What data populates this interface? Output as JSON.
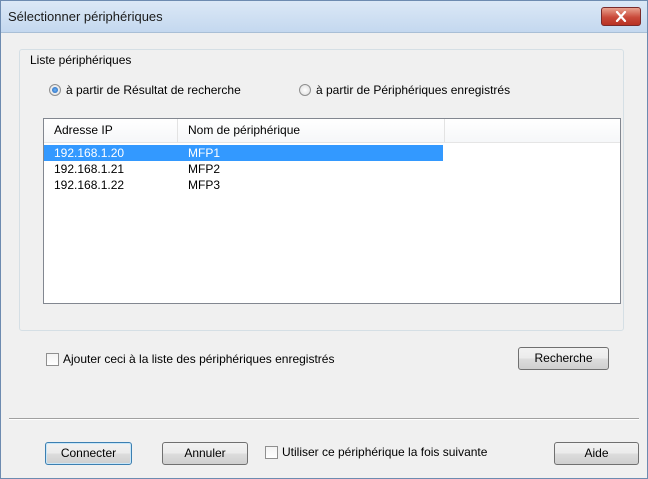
{
  "window": {
    "title": "Sélectionner périphériques"
  },
  "group": {
    "label": "Liste périphériques"
  },
  "radios": [
    {
      "label": "à partir de Résultat de recherche",
      "checked": true
    },
    {
      "label": "à partir de Périphériques enregistrés",
      "checked": false
    }
  ],
  "table": {
    "columns": [
      "Adresse IP",
      "Nom de périphérique"
    ],
    "rows": [
      {
        "ip": "192.168.1.20",
        "name": "MFP1",
        "selected": true
      },
      {
        "ip": "192.168.1.21",
        "name": "MFP2",
        "selected": false
      },
      {
        "ip": "192.168.1.22",
        "name": "MFP3",
        "selected": false
      }
    ]
  },
  "add_to_list": {
    "label": "Ajouter ceci à la liste des périphériques enregistrés",
    "checked": false
  },
  "search_button": "Recherche",
  "footer": {
    "connect": "Connecter",
    "cancel": "Annuler",
    "use_next_time": "Utiliser ce périphérique la fois suivante",
    "help": "Aide"
  }
}
